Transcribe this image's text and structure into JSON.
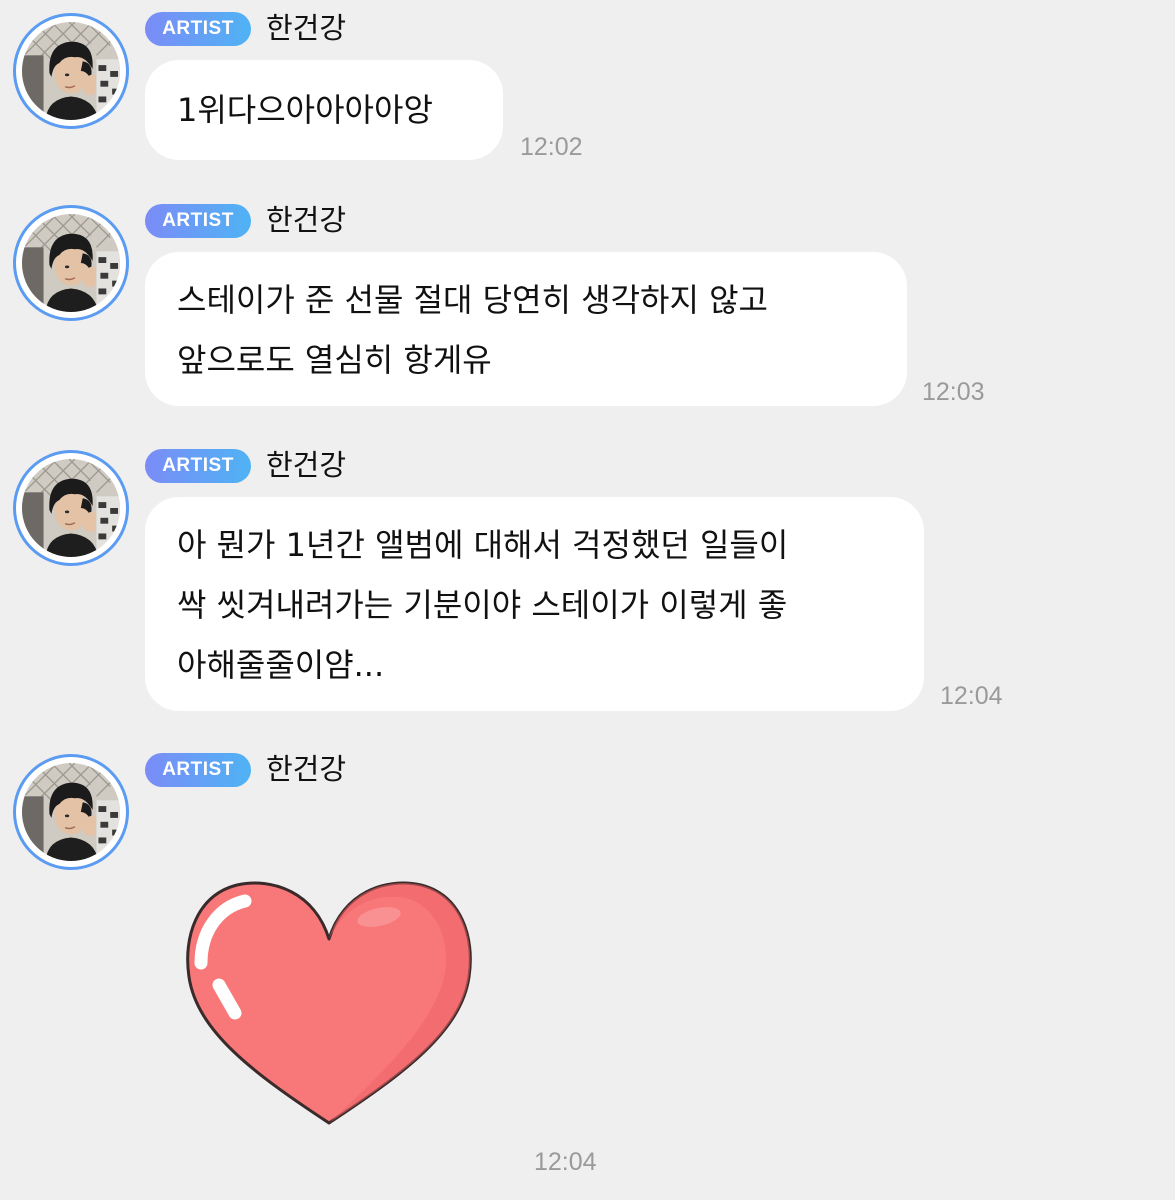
{
  "messages": [
    {
      "badge": "ARTIST",
      "sender": "한건강",
      "text": "1위다으아아아아앙",
      "time": "12:02"
    },
    {
      "badge": "ARTIST",
      "sender": "한건강",
      "text": "스테이가 준 선물 절대 당연히 생각하지 않고\n앞으로도 열심히 항게유",
      "time": "12:03"
    },
    {
      "badge": "ARTIST",
      "sender": "한건강",
      "text": "아 뭔가 1년간 앨범에 대해서 걱정했던 일들이\n싹 씻겨내려가는 기분이야 스테이가 이렇게 좋\n아해줄줄이얌...",
      "time": "12:04"
    },
    {
      "badge": "ARTIST",
      "sender": "한건강",
      "sticker": "heart-sticker",
      "time": "12:04"
    }
  ],
  "colors": {
    "background": "#efefef",
    "bubble": "#ffffff",
    "badge_start": "#7b8cf7",
    "badge_end": "#4fb3f4",
    "avatar_ring": "#5b9cf2",
    "heart": "#f8787a",
    "timestamp": "#9a9a9a"
  }
}
